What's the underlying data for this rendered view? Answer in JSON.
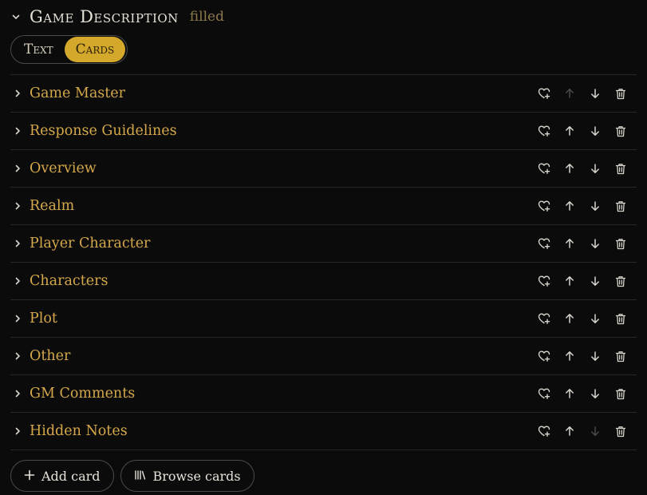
{
  "section": {
    "title": "Game Description",
    "status": "filled"
  },
  "toggle": {
    "options": [
      "Text",
      "Cards"
    ],
    "selected": "Cards"
  },
  "cards": [
    {
      "label": "Game Master",
      "up_enabled": false,
      "down_enabled": true
    },
    {
      "label": "Response Guidelines",
      "up_enabled": true,
      "down_enabled": true
    },
    {
      "label": "Overview",
      "up_enabled": true,
      "down_enabled": true
    },
    {
      "label": "Realm",
      "up_enabled": true,
      "down_enabled": true
    },
    {
      "label": "Player Character",
      "up_enabled": true,
      "down_enabled": true
    },
    {
      "label": "Characters",
      "up_enabled": true,
      "down_enabled": true
    },
    {
      "label": "Plot",
      "up_enabled": true,
      "down_enabled": true
    },
    {
      "label": "Other",
      "up_enabled": true,
      "down_enabled": true
    },
    {
      "label": "GM Comments",
      "up_enabled": true,
      "down_enabled": true
    },
    {
      "label": "Hidden Notes",
      "up_enabled": true,
      "down_enabled": false
    }
  ],
  "footer": {
    "add_label": "Add card",
    "browse_label": "Browse cards"
  },
  "icons": {
    "row_actions": [
      "heart-plus-icon",
      "arrow-up-icon",
      "arrow-down-icon",
      "trash-icon"
    ]
  },
  "colors": {
    "accent": "#d4a82a",
    "card_label": "#d4a84a",
    "status": "#8d7a4a",
    "icon": "#d8d4cc",
    "icon_disabled": "#4a4a4a"
  }
}
